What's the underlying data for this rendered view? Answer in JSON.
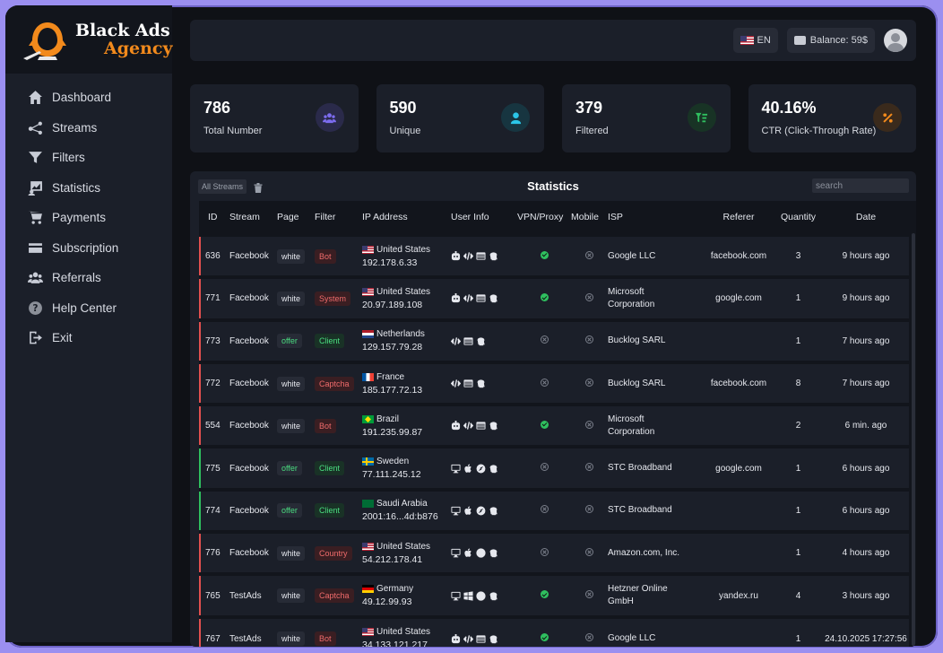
{
  "brand": {
    "line1": "Black Ads",
    "line2": "Agency",
    "accent": "#f28a1c"
  },
  "sidebar": {
    "items": [
      {
        "label": "Dashboard",
        "icon": "home-icon"
      },
      {
        "label": "Streams",
        "icon": "share-icon"
      },
      {
        "label": "Filters",
        "icon": "filter-icon"
      },
      {
        "label": "Statistics",
        "icon": "statistics-icon"
      },
      {
        "label": "Payments",
        "icon": "cart-icon"
      },
      {
        "label": "Subscription",
        "icon": "card-icon"
      },
      {
        "label": "Referrals",
        "icon": "users-icon"
      },
      {
        "label": "Help Center",
        "icon": "help-icon"
      },
      {
        "label": "Exit",
        "icon": "exit-icon"
      }
    ]
  },
  "topbar": {
    "language": "EN",
    "balance": "Balance: 59$"
  },
  "cards": [
    {
      "value": "786",
      "label": "Total Number",
      "icon": "users-icon",
      "color": "#7c6cf0",
      "bg": "#2a2a4a"
    },
    {
      "value": "590",
      "label": "Unique",
      "icon": "user-icon",
      "color": "#2bc6e8",
      "bg": "#173540"
    },
    {
      "value": "379",
      "label": "Filtered",
      "icon": "filter-list-icon",
      "color": "#2fbf5f",
      "bg": "#183325"
    },
    {
      "value": "40.16%",
      "label": "CTR (Click-Through Rate)",
      "icon": "percent-icon",
      "color": "#f28a1c",
      "bg": "#3a2a1c"
    }
  ],
  "panel": {
    "streams_button": "All Streams",
    "title": "Statistics",
    "search_placeholder": "search"
  },
  "table": {
    "columns": [
      "ID",
      "Stream",
      "Page",
      "Filter",
      "IP Address",
      "User Info",
      "VPN/Proxy",
      "Mobile",
      "ISP",
      "Referer",
      "Quantity",
      "Date"
    ],
    "rows": [
      {
        "id": "636",
        "stream": "Facebook",
        "page": "white",
        "filter": "Bot",
        "filter_type": "red",
        "bar": "red",
        "country": "United States",
        "flag": "us",
        "ip": "192.178.6.33",
        "info": [
          "robot-icon",
          "code-icon",
          "window-icon",
          "fingerprint-icon"
        ],
        "vpn": "yes",
        "mobile": "no",
        "isp": [
          "Google LLC"
        ],
        "referer": "facebook.com",
        "qty": "3",
        "date": "9 hours ago"
      },
      {
        "id": "771",
        "stream": "Facebook",
        "page": "white",
        "filter": "System",
        "filter_type": "red",
        "bar": "red",
        "country": "United States",
        "flag": "us",
        "ip": "20.97.189.108",
        "info": [
          "robot-icon",
          "code-icon",
          "window-icon",
          "fingerprint-icon"
        ],
        "vpn": "yes",
        "mobile": "no",
        "isp": [
          "Microsoft",
          "Corporation"
        ],
        "referer": "google.com",
        "qty": "1",
        "date": "9 hours ago"
      },
      {
        "id": "773",
        "stream": "Facebook",
        "page": "offer",
        "filter": "Client",
        "filter_type": "green",
        "bar": "red",
        "country": "Netherlands",
        "flag": "nl",
        "ip": "129.157.79.28",
        "info": [
          "code-icon",
          "window-icon",
          "fingerprint-icon"
        ],
        "vpn": "no",
        "mobile": "no",
        "isp": [
          "Bucklog SARL"
        ],
        "referer": "",
        "qty": "1",
        "date": "7 hours ago"
      },
      {
        "id": "772",
        "stream": "Facebook",
        "page": "white",
        "filter": "Captcha",
        "filter_type": "red",
        "bar": "red",
        "country": "France",
        "flag": "fr",
        "ip": "185.177.72.13",
        "info": [
          "code-icon",
          "window-icon",
          "fingerprint-icon"
        ],
        "vpn": "no",
        "mobile": "no",
        "isp": [
          "Bucklog SARL"
        ],
        "referer": "facebook.com",
        "qty": "8",
        "date": "7 hours ago"
      },
      {
        "id": "554",
        "stream": "Facebook",
        "page": "white",
        "filter": "Bot",
        "filter_type": "red",
        "bar": "red",
        "country": "Brazil",
        "flag": "br",
        "ip": "191.235.99.87",
        "info": [
          "robot-icon",
          "code-icon",
          "window-icon",
          "fingerprint-icon"
        ],
        "vpn": "yes",
        "mobile": "no",
        "isp": [
          "Microsoft",
          "Corporation"
        ],
        "referer": "",
        "qty": "2",
        "date": "6 min. ago"
      },
      {
        "id": "775",
        "stream": "Facebook",
        "page": "offer",
        "filter": "Client",
        "filter_type": "green",
        "bar": "green",
        "country": "Sweden",
        "flag": "se",
        "ip": "77.111.245.12",
        "info": [
          "desktop-icon",
          "apple-icon",
          "safari-icon",
          "fingerprint-icon"
        ],
        "vpn": "no",
        "mobile": "no",
        "isp": [
          "STC Broadband"
        ],
        "referer": "google.com",
        "qty": "1",
        "date": "6 hours ago"
      },
      {
        "id": "774",
        "stream": "Facebook",
        "page": "offer",
        "filter": "Client",
        "filter_type": "green",
        "bar": "green",
        "country": "Saudi Arabia",
        "flag": "sa",
        "ip": "2001:16...4d:b876",
        "info": [
          "desktop-icon",
          "apple-icon",
          "safari-icon",
          "fingerprint-icon"
        ],
        "vpn": "no",
        "mobile": "no",
        "isp": [
          "STC Broadband"
        ],
        "referer": "",
        "qty": "1",
        "date": "6 hours ago"
      },
      {
        "id": "776",
        "stream": "Facebook",
        "page": "white",
        "filter": "Country",
        "filter_type": "red",
        "bar": "red",
        "country": "United States",
        "flag": "us",
        "ip": "54.212.178.41",
        "info": [
          "desktop-icon",
          "apple-icon",
          "chrome-icon",
          "fingerprint-icon"
        ],
        "vpn": "no",
        "mobile": "no",
        "isp": [
          "Amazon.com, Inc."
        ],
        "referer": "",
        "qty": "1",
        "date": "4 hours ago"
      },
      {
        "id": "765",
        "stream": "TestAds",
        "page": "white",
        "filter": "Captcha",
        "filter_type": "red",
        "bar": "red",
        "country": "Germany",
        "flag": "de",
        "ip": "49.12.99.93",
        "info": [
          "desktop-icon",
          "windows-icon",
          "chrome-icon",
          "fingerprint-icon"
        ],
        "vpn": "yes",
        "mobile": "no",
        "isp": [
          "Hetzner Online",
          "GmbH"
        ],
        "referer": "yandex.ru",
        "qty": "4",
        "date": "3 hours ago"
      },
      {
        "id": "767",
        "stream": "TestAds",
        "page": "white",
        "filter": "Bot",
        "filter_type": "red",
        "bar": "red",
        "country": "United States",
        "flag": "us",
        "ip": "34.133.121.217",
        "info": [
          "robot-icon",
          "code-icon",
          "window-icon",
          "fingerprint-icon"
        ],
        "vpn": "yes",
        "mobile": "no",
        "isp": [
          "Google LLC"
        ],
        "referer": "",
        "qty": "1",
        "date": "24.10.2025 17:27:56"
      }
    ]
  }
}
